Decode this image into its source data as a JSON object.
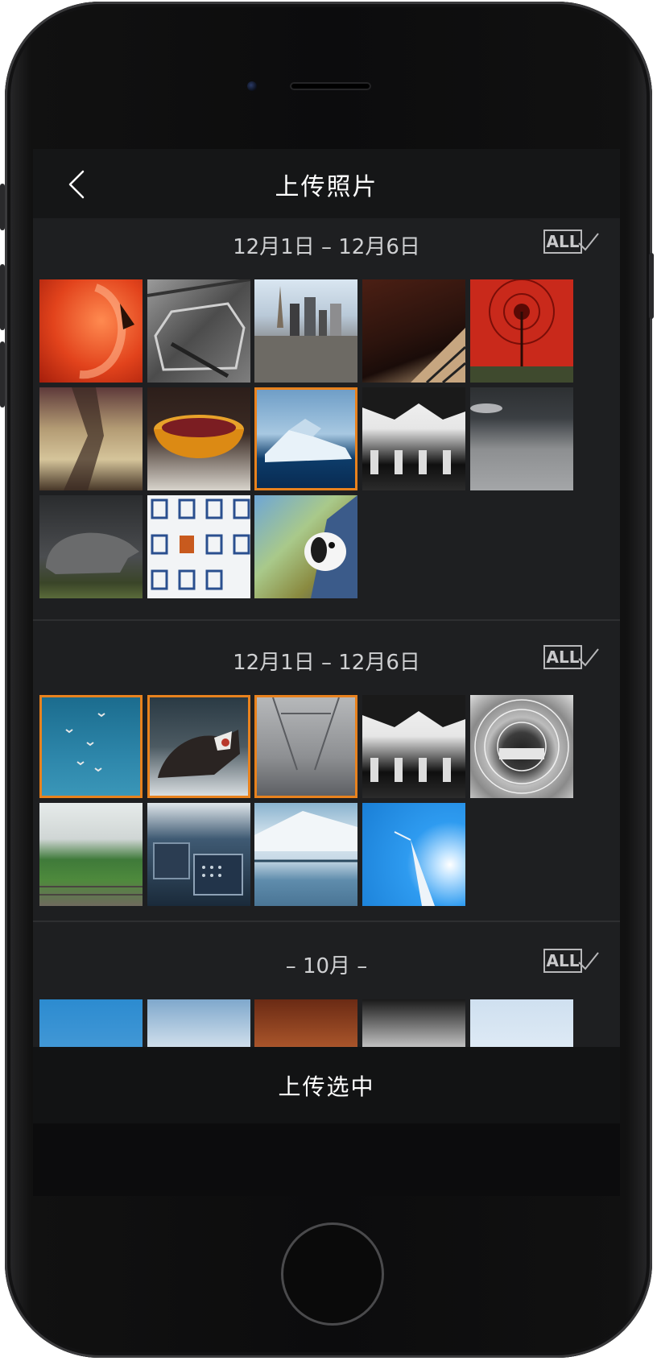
{
  "nav": {
    "title": "上传照片"
  },
  "sections": [
    {
      "title": "12月1日 – 12月6日",
      "all_label": "ALL"
    },
    {
      "title": "12月1日 – 12月6日",
      "all_label": "ALL"
    },
    {
      "title": "– 10月 –",
      "all_label": "ALL"
    }
  ],
  "footer": {
    "upload_label": "上传选中"
  },
  "colors": {
    "accent": "#e8821e",
    "background": "#1e1f21",
    "navbar": "#151617"
  },
  "photos": {
    "section1": [
      {
        "subject": "flamingo",
        "selected": false
      },
      {
        "subject": "wrecked-car",
        "selected": false
      },
      {
        "subject": "city-skyline",
        "selected": false
      },
      {
        "subject": "piano-keys",
        "selected": false
      },
      {
        "subject": "red-umbrella",
        "selected": false
      },
      {
        "subject": "tree-silhouette",
        "selected": false
      },
      {
        "subject": "cherry-bowl",
        "selected": false
      },
      {
        "subject": "iceberg",
        "selected": true
      },
      {
        "subject": "forest-bw",
        "selected": false
      },
      {
        "subject": "snow-field",
        "selected": false
      },
      {
        "subject": "rhino",
        "selected": false
      },
      {
        "subject": "building-windows",
        "selected": false
      },
      {
        "subject": "dog-in-car",
        "selected": false
      }
    ],
    "section2": [
      {
        "subject": "birds-sky",
        "selected": true
      },
      {
        "subject": "husky",
        "selected": true
      },
      {
        "subject": "foggy-corridor",
        "selected": true
      },
      {
        "subject": "forest-bw",
        "selected": false
      },
      {
        "subject": "tunnel-bw",
        "selected": false
      },
      {
        "subject": "rail-landscape",
        "selected": false
      },
      {
        "subject": "cockpit",
        "selected": false
      },
      {
        "subject": "snowy-mountain-lake",
        "selected": false
      },
      {
        "subject": "wind-turbine",
        "selected": false
      }
    ],
    "section3": [
      {
        "subject": "sky",
        "selected": false
      },
      {
        "subject": "clouds",
        "selected": false
      },
      {
        "subject": "laptop",
        "selected": false
      },
      {
        "subject": "forest-bw",
        "selected": false
      },
      {
        "subject": "white",
        "selected": false
      }
    ]
  }
}
